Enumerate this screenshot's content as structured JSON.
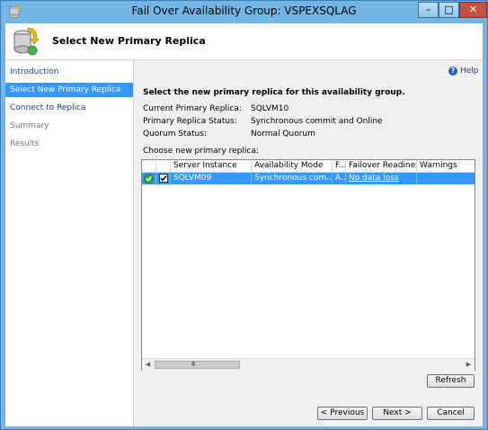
{
  "window": {
    "title": "Fail Over Availability Group: VSPEXSQLAG",
    "min_glyph": "–",
    "max_glyph": "□",
    "close_glyph": "✕"
  },
  "header": {
    "title": "Select New Primary Replica"
  },
  "nav": {
    "items": [
      {
        "label": "Introduction",
        "state": "link"
      },
      {
        "label": "Select New Primary Replica",
        "state": "selected"
      },
      {
        "label": "Connect to Replica",
        "state": "link"
      },
      {
        "label": "Summary",
        "state": "disabled"
      },
      {
        "label": "Results",
        "state": "disabled"
      }
    ]
  },
  "help": {
    "label": "Help"
  },
  "main": {
    "instruction": "Select the new primary replica for this availability group.",
    "info": [
      {
        "label": "Current Primary Replica:",
        "value": "SQLVM10"
      },
      {
        "label": "Primary Replica Status:",
        "value": "Synchronous commit and Online"
      },
      {
        "label": "Quorum Status:",
        "value": "Normal Quorum"
      }
    ],
    "choose_label": "Choose new primary replica:"
  },
  "grid": {
    "columns": [
      "",
      "",
      "Server Instance",
      "Availability Mode",
      "F...",
      "Failover Readiness",
      "Warnings"
    ],
    "rows": [
      {
        "server_instance": "SQLVM09",
        "availability_mode": "Synchronous com...",
        "f": "A...",
        "failover_readiness": "No data loss",
        "warnings": "",
        "selected": true,
        "checked": true
      }
    ],
    "scroll_grip": "III"
  },
  "buttons": {
    "refresh": "Refresh",
    "previous": "< Previous",
    "next": "Next >",
    "cancel": "Cancel"
  },
  "colors": {
    "selection": "#3399ff",
    "titlebar": "#73b6e5",
    "close": "#c7503e"
  }
}
